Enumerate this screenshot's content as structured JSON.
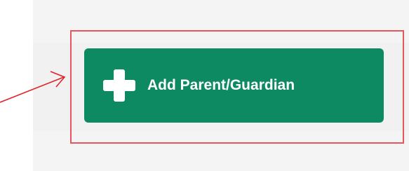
{
  "button": {
    "label": "Add Parent/Guardian",
    "icon": "plus-icon",
    "color": "#0e8a63"
  },
  "annotation": {
    "highlight_color": "#e8565d",
    "arrow_color": "#e0242b"
  }
}
